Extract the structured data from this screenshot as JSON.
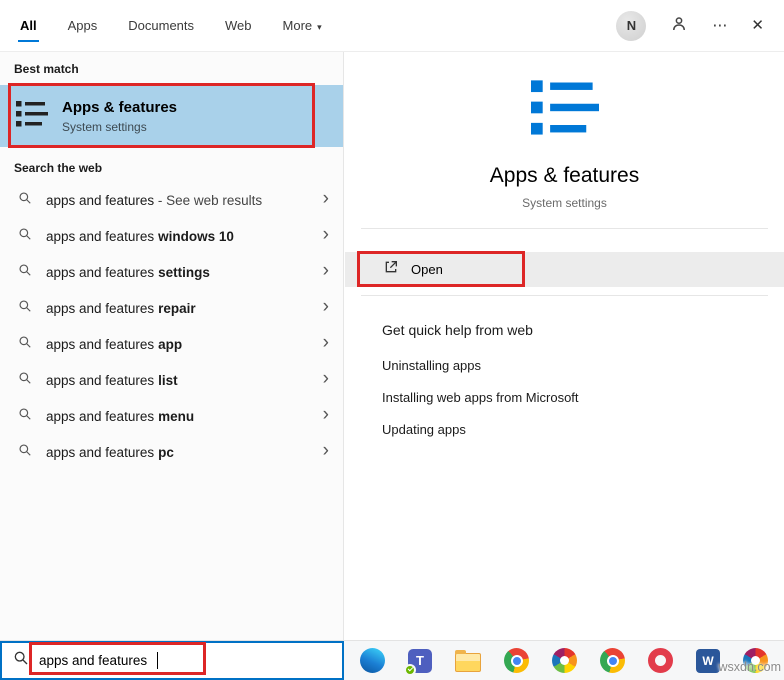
{
  "topbar": {
    "tabs": [
      {
        "label": "All",
        "active": true
      },
      {
        "label": "Apps",
        "active": false
      },
      {
        "label": "Documents",
        "active": false
      },
      {
        "label": "Web",
        "active": false
      },
      {
        "label": "More",
        "active": false
      }
    ],
    "more_caret": "▾",
    "avatar_letter": "N",
    "ellipsis": "⋯",
    "close": "✕"
  },
  "left_panel": {
    "best_match_header": "Best match",
    "best_match": {
      "title": "Apps & features",
      "subtitle": "System settings"
    },
    "search_web_header": "Search the web",
    "suggestions": [
      {
        "query": "apps and features",
        "note": " - See web results",
        "completion": ""
      },
      {
        "query": "apps and features",
        "completion": "windows 10"
      },
      {
        "query": "apps and features",
        "completion": "settings"
      },
      {
        "query": "apps and features",
        "completion": "repair"
      },
      {
        "query": "apps and features",
        "completion": "app"
      },
      {
        "query": "apps and features",
        "completion": "list"
      },
      {
        "query": "apps and features",
        "completion": "menu"
      },
      {
        "query": "apps and features",
        "completion": "pc"
      }
    ],
    "search_input": {
      "value": "apps and features",
      "placeholder": ""
    }
  },
  "right_panel": {
    "title": "Apps & features",
    "subtitle": "System settings",
    "open_label": "Open",
    "help_header": "Get quick help from web",
    "help_links": [
      {
        "label": "Uninstalling apps"
      },
      {
        "label": "Installing web apps from Microsoft"
      },
      {
        "label": "Updating apps"
      }
    ]
  },
  "taskbar": {
    "icons": [
      {
        "name": "edge"
      },
      {
        "name": "teams",
        "glyph": "T"
      },
      {
        "name": "file-explorer"
      },
      {
        "name": "chrome"
      },
      {
        "name": "color-pinwheel"
      },
      {
        "name": "chrome"
      },
      {
        "name": "opera"
      },
      {
        "name": "word",
        "glyph": "W"
      },
      {
        "name": "color-pinwheel"
      }
    ]
  },
  "glyphs": {
    "chevron": "›"
  },
  "watermark": "wsxdn.com",
  "colors": {
    "accent": "#0078d7",
    "best_match_highlight": "#a9d1ea",
    "annotation_red": "#dd2626",
    "search_border": "#0071c5"
  }
}
